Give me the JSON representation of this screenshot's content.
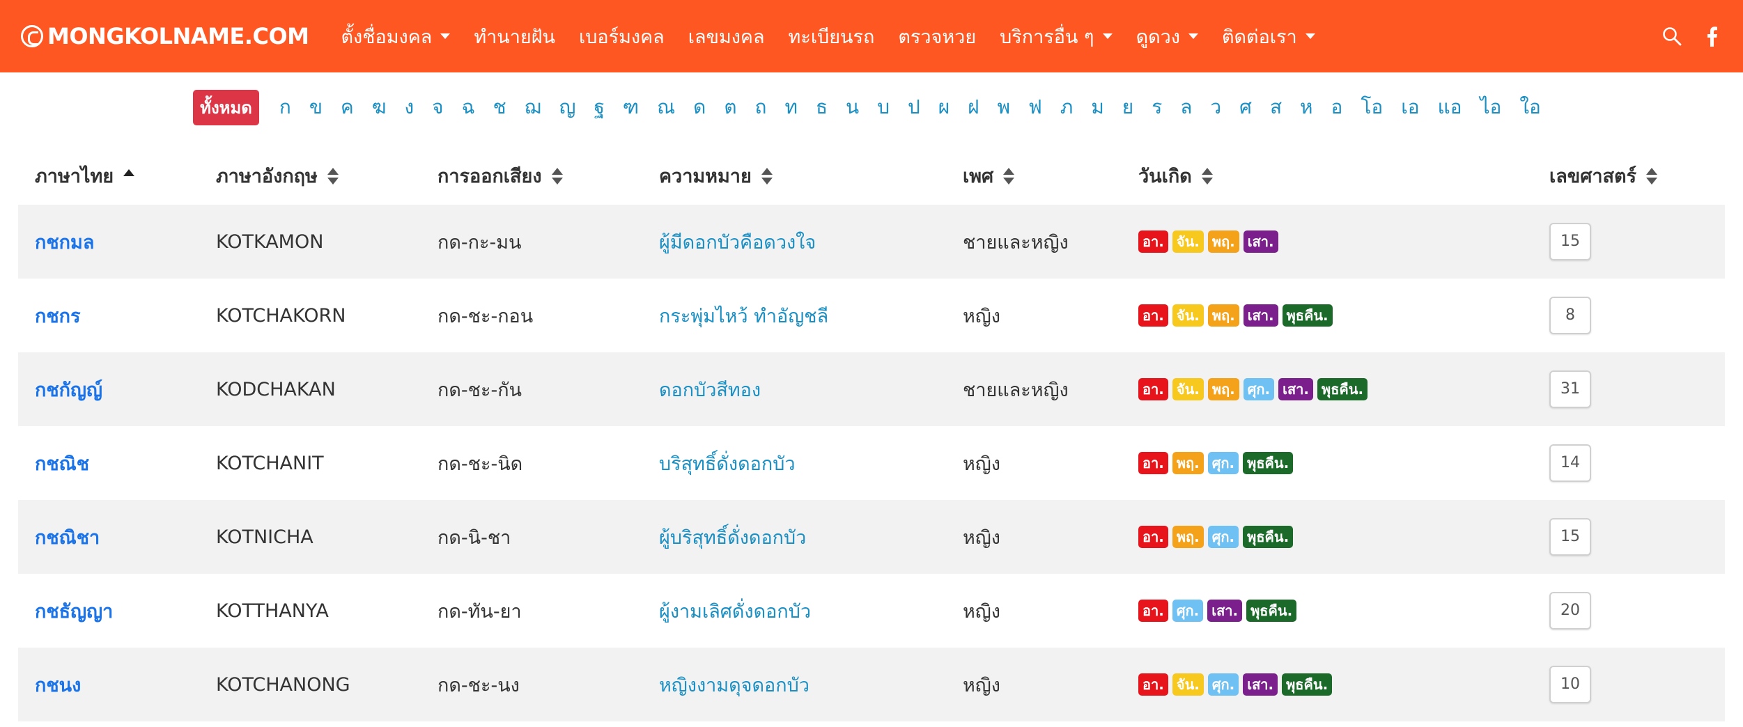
{
  "brand": "MONGKOLNAME.COM",
  "colors": {
    "nav_bg": "#ff5722",
    "all_badge": "#dc3545",
    "link": "#1a73e8",
    "meaning": "#1a8fc4"
  },
  "nav": [
    {
      "label": "ตั้งชื่อมงคล",
      "dropdown": true
    },
    {
      "label": "ทำนายฝัน",
      "dropdown": false
    },
    {
      "label": "เบอร์มงคล",
      "dropdown": false
    },
    {
      "label": "เลขมงคล",
      "dropdown": false
    },
    {
      "label": "ทะเบียนรถ",
      "dropdown": false
    },
    {
      "label": "ตรวจหวย",
      "dropdown": false
    },
    {
      "label": "บริการอื่น ๆ",
      "dropdown": true
    },
    {
      "label": "ดูดวง",
      "dropdown": true
    },
    {
      "label": "ติดต่อเรา",
      "dropdown": true
    }
  ],
  "nav_icons": [
    "search-icon",
    "facebook-icon"
  ],
  "letter_all": "ทั้งหมด",
  "letters": [
    "ก",
    "ข",
    "ค",
    "ฆ",
    "ง",
    "จ",
    "ฉ",
    "ช",
    "ฌ",
    "ญ",
    "ฐ",
    "ฑ",
    "ณ",
    "ด",
    "ต",
    "ถ",
    "ท",
    "ธ",
    "น",
    "บ",
    "ป",
    "ผ",
    "ฝ",
    "พ",
    "ฟ",
    "ภ",
    "ม",
    "ย",
    "ร",
    "ล",
    "ว",
    "ศ",
    "ส",
    "ห",
    "อ",
    "โอ",
    "เอ",
    "แอ",
    "ไอ",
    "ใอ"
  ],
  "table": {
    "headers": [
      {
        "label": "ภาษาไทย",
        "sort": "asc"
      },
      {
        "label": "ภาษาอังกฤษ",
        "sort": "both"
      },
      {
        "label": "การออกเสียง",
        "sort": "both"
      },
      {
        "label": "ความหมาย",
        "sort": "both"
      },
      {
        "label": "เพศ",
        "sort": "both"
      },
      {
        "label": "วันเกิด",
        "sort": "both"
      },
      {
        "label": "เลขศาสตร์",
        "sort": "both"
      }
    ],
    "day_colors": {
      "อา.": "#e8141c",
      "จัน.": "#f7c81e",
      "พฤ.": "#f5a21b",
      "ศุก.": "#6ec1f2",
      "เสา.": "#7b1f8c",
      "พุธคืน.": "#1b6a2a"
    },
    "rows": [
      {
        "thai": "กชกมล",
        "eng": "KOTKAMON",
        "pron": "กด-กะ-มน",
        "meaning": "ผู้มีดอกบัวคือดวงใจ",
        "gender": "ชายและหญิง",
        "days": [
          "อา.",
          "จัน.",
          "พฤ.",
          "เสา."
        ],
        "num": "15"
      },
      {
        "thai": "กชกร",
        "eng": "KOTCHAKORN",
        "pron": "กด-ชะ-กอน",
        "meaning": "กระพุ่มไหว้ ทำอัญชลี",
        "gender": "หญิง",
        "days": [
          "อา.",
          "จัน.",
          "พฤ.",
          "เสา.",
          "พุธคืน."
        ],
        "num": "8"
      },
      {
        "thai": "กชกัญญ์",
        "eng": "KODCHAKAN",
        "pron": "กด-ชะ-กัน",
        "meaning": "ดอกบัวสีทอง",
        "gender": "ชายและหญิง",
        "days": [
          "อา.",
          "จัน.",
          "พฤ.",
          "ศุก.",
          "เสา.",
          "พุธคืน."
        ],
        "num": "31"
      },
      {
        "thai": "กชณิช",
        "eng": "KOTCHANIT",
        "pron": "กด-ชะ-นิด",
        "meaning": "บริสุทธิ์ดั่งดอกบัว",
        "gender": "หญิง",
        "days": [
          "อา.",
          "พฤ.",
          "ศุก.",
          "พุธคืน."
        ],
        "num": "14"
      },
      {
        "thai": "กชณิชา",
        "eng": "KOTNICHA",
        "pron": "กด-นิ-ชา",
        "meaning": "ผู้บริสุทธิ์ดั่งดอกบัว",
        "gender": "หญิง",
        "days": [
          "อา.",
          "พฤ.",
          "ศุก.",
          "พุธคืน."
        ],
        "num": "15"
      },
      {
        "thai": "กชธัญญา",
        "eng": "KOTTHANYA",
        "pron": "กด-ทัน-ยา",
        "meaning": "ผู้งามเลิศดั่งดอกบัว",
        "gender": "หญิง",
        "days": [
          "อา.",
          "ศุก.",
          "เสา.",
          "พุธคืน."
        ],
        "num": "20"
      },
      {
        "thai": "กชนง",
        "eng": "KOTCHANONG",
        "pron": "กด-ชะ-นง",
        "meaning": "หญิงงามดุจดอกบัว",
        "gender": "หญิง",
        "days": [
          "อา.",
          "จัน.",
          "ศุก.",
          "เสา.",
          "พุธคืน."
        ],
        "num": "10"
      }
    ]
  }
}
